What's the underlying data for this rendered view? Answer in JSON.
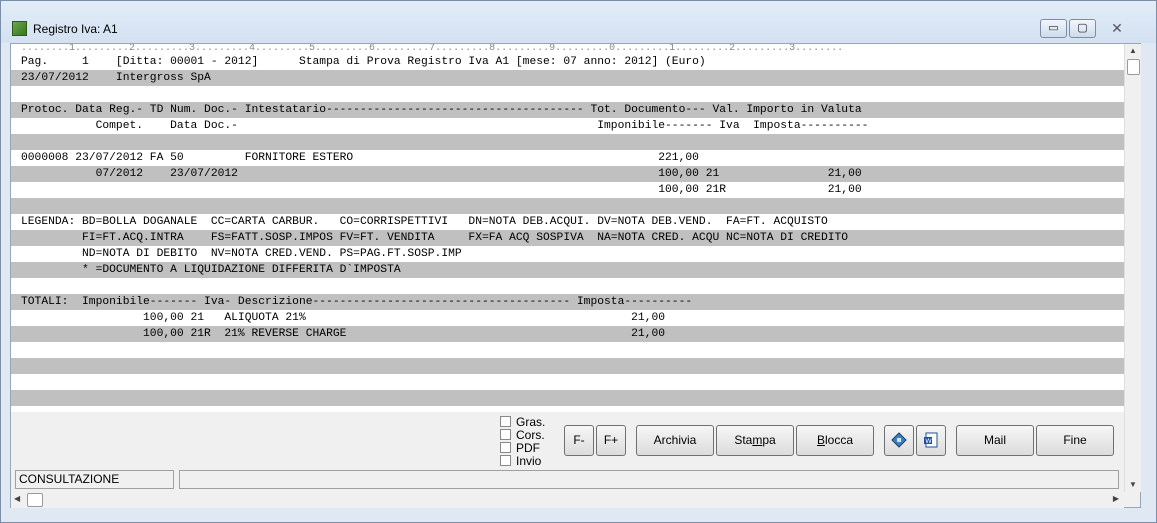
{
  "window": {
    "title": "Registro Iva: A1",
    "minimize_glyph": "▭",
    "maximize_glyph": "▢",
    "close_glyph": "✕"
  },
  "report": {
    "ruler": "........1.........2.........3.........4.........5.........6.........7.........8.........9.........0.........1.........2.........3........",
    "rows": [
      {
        "text": "Pag.     1    [Ditta: 00001 - 2012]      Stampa di Prova Registro Iva A1 [mese: 07 anno: 2012] (Euro)",
        "shade": false
      },
      {
        "text": "23/07/2012    Intergross SpA",
        "shade": true
      },
      {
        "text": "",
        "shade": false
      },
      {
        "text": "Protoc. Data Reg.- TD Num. Doc.- Intestatario-------------------------------------- Tot. Documento--- Val. Importo in Valuta",
        "shade": true
      },
      {
        "text": "           Compet.    Data Doc.-                                                     Imponibile------- Iva  Imposta----------",
        "shade": false
      },
      {
        "text": "",
        "shade": true
      },
      {
        "text": "0000008 23/07/2012 FA 50         FORNITORE ESTERO                                             221,00",
        "shade": false
      },
      {
        "text": "           07/2012    23/07/2012                                                              100,00 21                21,00",
        "shade": true
      },
      {
        "text": "                                                                                              100,00 21R               21,00",
        "shade": false
      },
      {
        "text": "",
        "shade": true
      },
      {
        "text": "LEGENDA: BD=BOLLA DOGANALE  CC=CARTA CARBUR.   CO=CORRISPETTIVI   DN=NOTA DEB.ACQUI. DV=NOTA DEB.VEND.  FA=FT. ACQUISTO",
        "shade": false
      },
      {
        "text": "         FI=FT.ACQ.INTRA    FS=FATT.SOSP.IMPOS FV=FT. VENDITA     FX=FA ACQ SOSPIVA  NA=NOTA CRED. ACQU NC=NOTA DI CREDITO",
        "shade": true
      },
      {
        "text": "         ND=NOTA DI DEBITO  NV=NOTA CRED.VEND. PS=PAG.FT.SOSP.IMP",
        "shade": false
      },
      {
        "text": "         * =DOCUMENTO A LIQUIDAZIONE DIFFERITA D`IMPOSTA",
        "shade": true
      },
      {
        "text": "",
        "shade": false
      },
      {
        "text": "TOTALI:  Imponibile------- Iva- Descrizione-------------------------------------- Imposta----------",
        "shade": true
      },
      {
        "text": "                  100,00 21   ALIQUOTA 21%                                                21,00",
        "shade": false
      },
      {
        "text": "                  100,00 21R  21% REVERSE CHARGE                                          21,00",
        "shade": true
      },
      {
        "text": "",
        "shade": false
      },
      {
        "text": "",
        "shade": true
      },
      {
        "text": "",
        "shade": false
      },
      {
        "text": "",
        "shade": true
      }
    ]
  },
  "options": {
    "gras": "Gras.",
    "cors": "Cors.",
    "pdf": "PDF",
    "invio": "Invio"
  },
  "buttons": {
    "font_minus": "F-",
    "font_plus": "F+",
    "archivia": "Archivia",
    "stampa_pre": "Sta",
    "stampa_u": "m",
    "stampa_post": "pa",
    "blocca_u": "B",
    "blocca_post": "locca",
    "mail": "Mail",
    "fine": "Fine",
    "icon1": "diskette-icon",
    "icon2": "word-document-icon"
  },
  "status": {
    "mode": "CONSULTAZIONE",
    "message": ""
  },
  "scroll": {
    "up": "▲",
    "down": "▼",
    "left": "◀",
    "right": "▶"
  }
}
